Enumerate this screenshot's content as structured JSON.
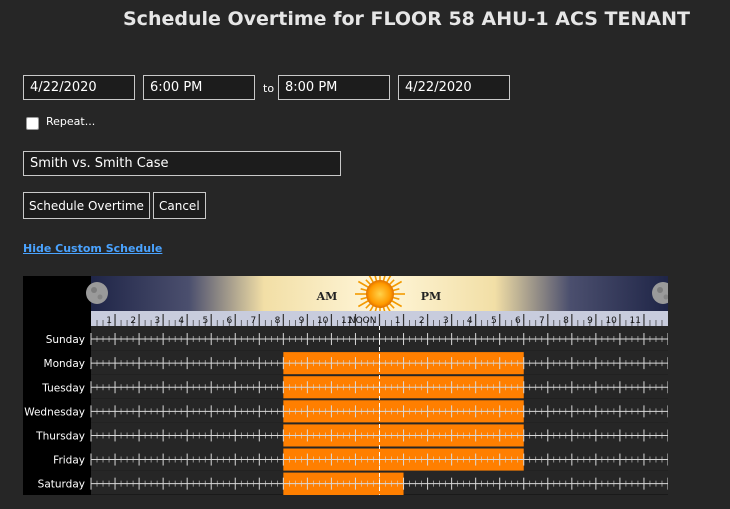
{
  "title": "Schedule Overtime for FLOOR 58 AHU-1 ACS TENANT",
  "start_date": "4/22/2020",
  "start_time": "6:00 PM",
  "to_label": "to",
  "end_time": "8:00 PM",
  "end_date": "4/22/2020",
  "repeat_label": "Repeat...",
  "repeat_checked": false,
  "description": "Smith vs. Smith Case",
  "schedule_button": "Schedule Overtime",
  "cancel_button": "Cancel",
  "hide_schedule_link": "Hide Custom Schedule",
  "banner": {
    "am": "AM",
    "pm": "PM"
  },
  "hour_labels": [
    "1",
    "2",
    "3",
    "4",
    "5",
    "6",
    "7",
    "8",
    "9",
    "10",
    "11",
    "NOON",
    "1",
    "2",
    "3",
    "4",
    "5",
    "6",
    "7",
    "8",
    "9",
    "10",
    "11"
  ],
  "days": [
    "Sunday",
    "Monday",
    "Tuesday",
    "Wednesday",
    "Thursday",
    "Friday",
    "Saturday"
  ],
  "occupied_hours": [
    null,
    [
      8,
      18
    ],
    [
      8,
      18
    ],
    [
      8,
      18
    ],
    [
      8,
      18
    ],
    [
      8,
      18
    ],
    [
      8,
      13
    ]
  ],
  "colors": {
    "occupied": "#ff7f00",
    "accent_link": "#4aa3ff"
  }
}
